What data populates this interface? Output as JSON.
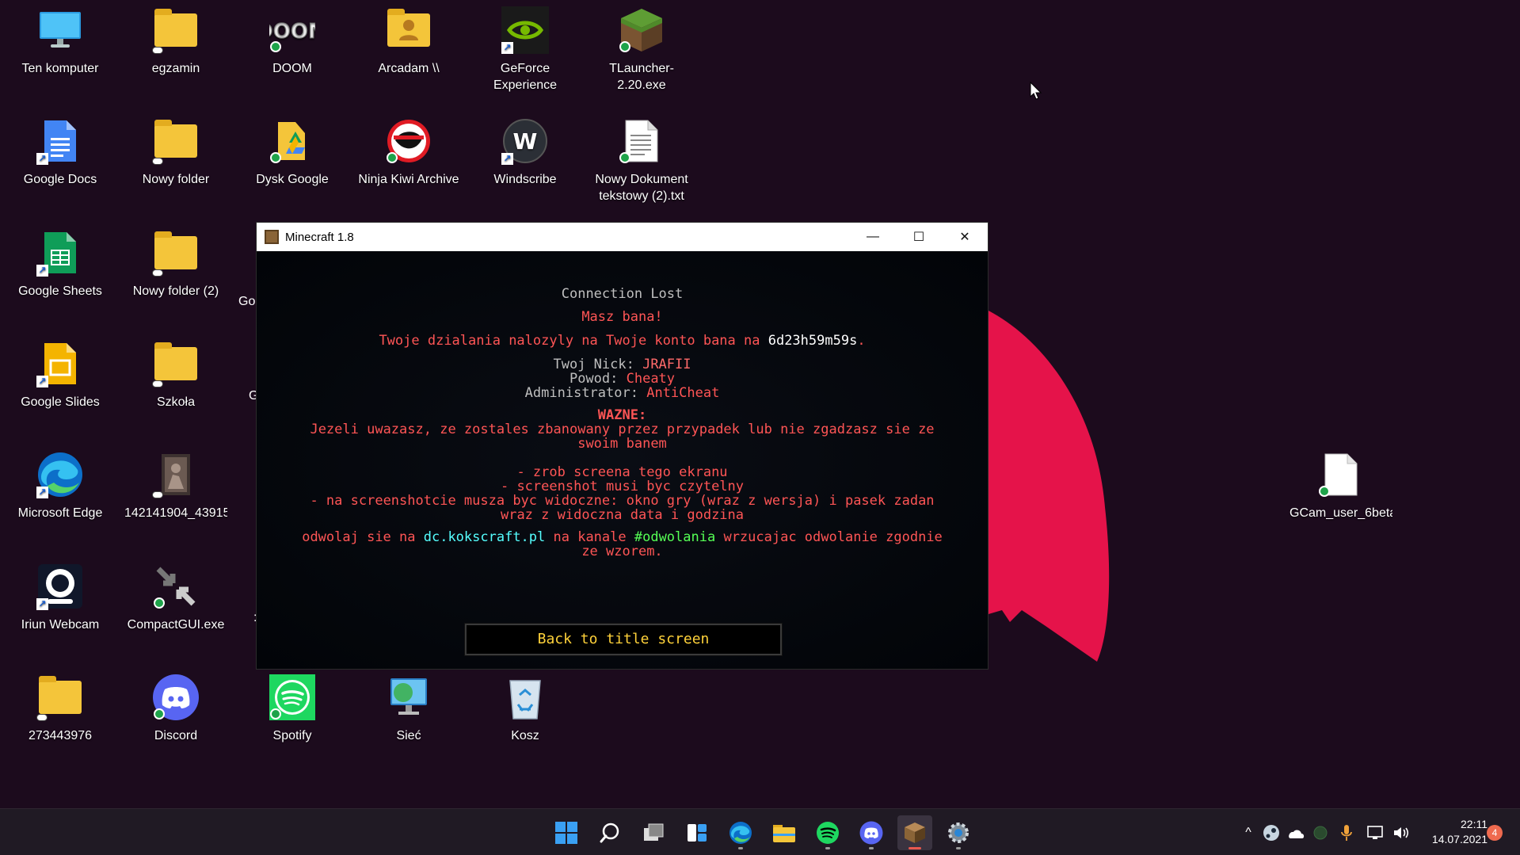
{
  "desktop": {
    "icons": [
      {
        "label": "Ten komputer"
      },
      {
        "label": "egzamin"
      },
      {
        "label": "DOOM"
      },
      {
        "label": "Arcadam \\\\"
      },
      {
        "label": "GeForce Experience"
      },
      {
        "label": "TLauncher-2.20.exe"
      },
      {
        "label": "Google Docs"
      },
      {
        "label": "Nowy folder"
      },
      {
        "label": "Dysk Google"
      },
      {
        "label": "Ninja Kiwi Archive"
      },
      {
        "label": "Windscribe"
      },
      {
        "label": "Nowy Dokument tekstowy (2).txt"
      },
      {
        "label": "Google Sheets"
      },
      {
        "label": "Nowy folder (2)"
      },
      {
        "label": "Google Slides"
      },
      {
        "label": "Szkoła"
      },
      {
        "label": "Microsoft Edge"
      },
      {
        "label": "142141904_43915..."
      },
      {
        "label": "Iriun Webcam"
      },
      {
        "label": "CompactGUI.exe"
      },
      {
        "label": "273443976"
      },
      {
        "label": "Discord"
      },
      {
        "label": "Spotify"
      },
      {
        "label": "Sieć"
      },
      {
        "label": "Kosz"
      },
      {
        "label": "GCam_user_6beta..."
      }
    ],
    "partial_labels": [
      "Go",
      "G",
      ":"
    ]
  },
  "window": {
    "title": "Minecraft 1.8",
    "minimize_glyph": "—",
    "maximize_glyph": "☐",
    "close_glyph": "✕"
  },
  "game": {
    "heading": "Connection Lost",
    "banned": "Masz bana!",
    "reason_prefix": "Twoje dzialania nalozyly na Twoje konto bana na ",
    "duration": "6d23h59m59s",
    "reason_suffix": ".",
    "nick_label": "Twoj Nick: ",
    "nick_value": "JRAFII",
    "reason_label": "Powod: ",
    "reason_value": "Cheaty",
    "admin_label": "Administrator: ",
    "admin_value": "AntiCheat",
    "important": "WAZNE:",
    "important_line1": "Jezeli uwazasz, ze zostales zbanowany przez przypadek lub nie zgadzasz sie ze",
    "important_line2": "swoim banem",
    "step1": "- zrob screena tego ekranu",
    "step2": "- screenshot musi byc czytelny",
    "step3": "- na screenshotcie musza byc widoczne: okno gry (wraz z wersja) i pasek zadan",
    "step4": "wraz z widoczna data i godzina",
    "appeal_prefix": "odwolaj sie na ",
    "appeal_site": "dc.kokscraft.pl",
    "appeal_mid": " na kanale ",
    "appeal_channel": "#odwolania",
    "appeal_suffix": " wrzucajac odwolanie zgodnie",
    "appeal_line2": "ze wzorem.",
    "back_button": "Back to title screen"
  },
  "taskbar": {
    "apps": [
      "start-icon",
      "search-icon",
      "task-view-icon",
      "widgets-icon",
      "edge-icon",
      "file-explorer-icon",
      "spotify-icon",
      "discord-icon",
      "minecraft-icon",
      "settings-icon"
    ],
    "tray": {
      "chevron": "^",
      "time": "22:11",
      "date": "14.07.2021",
      "notifications": "4"
    }
  },
  "colors": {
    "wallpaper": "#1c0b1d",
    "accent_shape": "#e5134a",
    "taskbar": "#201a24"
  }
}
